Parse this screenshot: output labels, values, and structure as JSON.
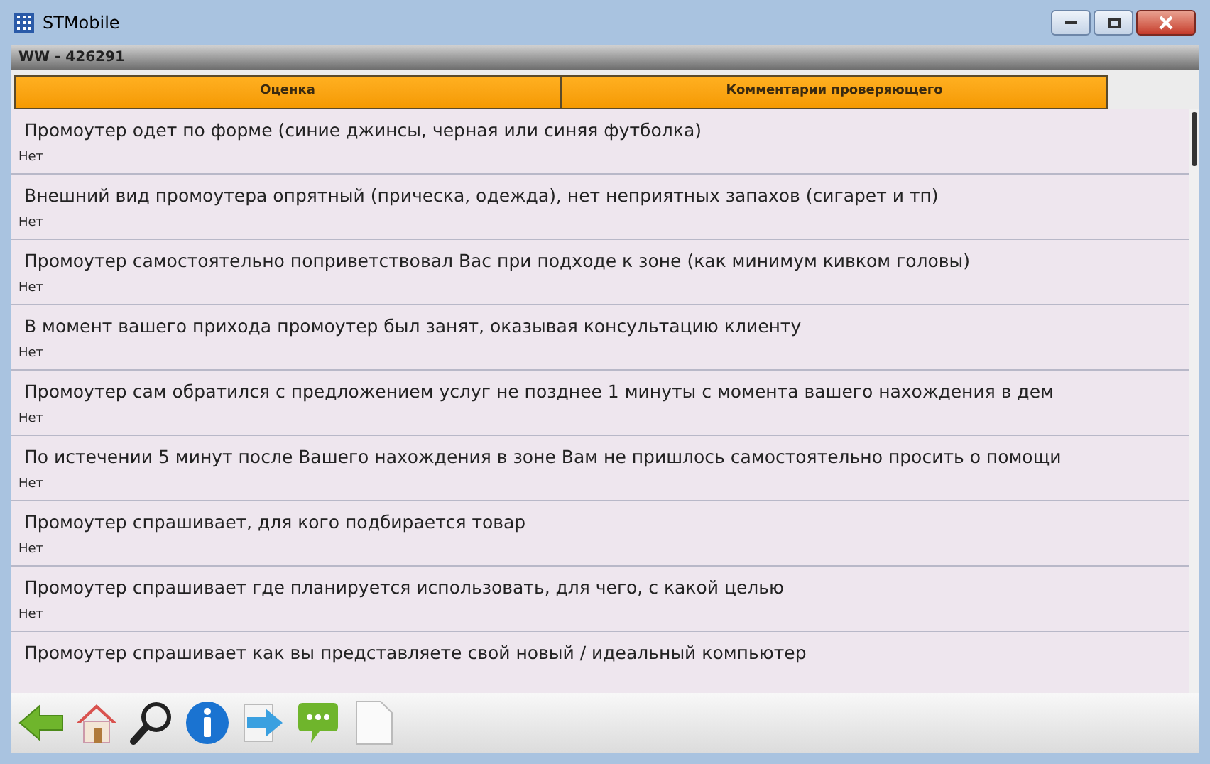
{
  "window": {
    "title": "STMobile"
  },
  "subtitle": "WW - 426291",
  "table": {
    "columns": [
      "Оценка",
      "Комментарии  проверяющего"
    ],
    "rows": [
      {
        "question": "Промоутер одет по форме (синие джинсы, черная или синяя футболка)",
        "answer": "Нет"
      },
      {
        "question": "Внешний вид промоутера опрятный (прическа,  одежда), нет неприятных запахов (сигарет и тп)",
        "answer": "Нет"
      },
      {
        "question": "Промоутер самостоятельно поприветствовал Вас при подходе к зоне (как минимум кивком головы)",
        "answer": "Нет"
      },
      {
        "question": "В момент вашего прихода  промоутер был занят, оказывая консультацию клиенту",
        "answer": "Нет"
      },
      {
        "question": "Промоутер сам  обратился с предложением услуг не позднее 1 минуты с  момента вашего нахождения в дем",
        "answer": "Нет"
      },
      {
        "question": "По истечении 5 минут после Вашего нахождения в зоне Вам не пришлось самостоятельно просить о помощи",
        "answer": "Нет"
      },
      {
        "question": "Промоутер спрашивает, для кого подбирается товар",
        "answer": "Нет"
      },
      {
        "question": "Промоутер спрашивает где планируется использовать, для чего, с какой целью",
        "answer": "Нет"
      },
      {
        "question": "Промоутер спрашивает как вы представляете свой новый / идеальный компьютер"
      }
    ]
  },
  "toolbar": [
    {
      "kind": "back"
    },
    {
      "kind": "home"
    },
    {
      "kind": "search"
    },
    {
      "kind": "info"
    },
    {
      "kind": "export"
    },
    {
      "kind": "comment"
    },
    {
      "kind": "document"
    }
  ]
}
